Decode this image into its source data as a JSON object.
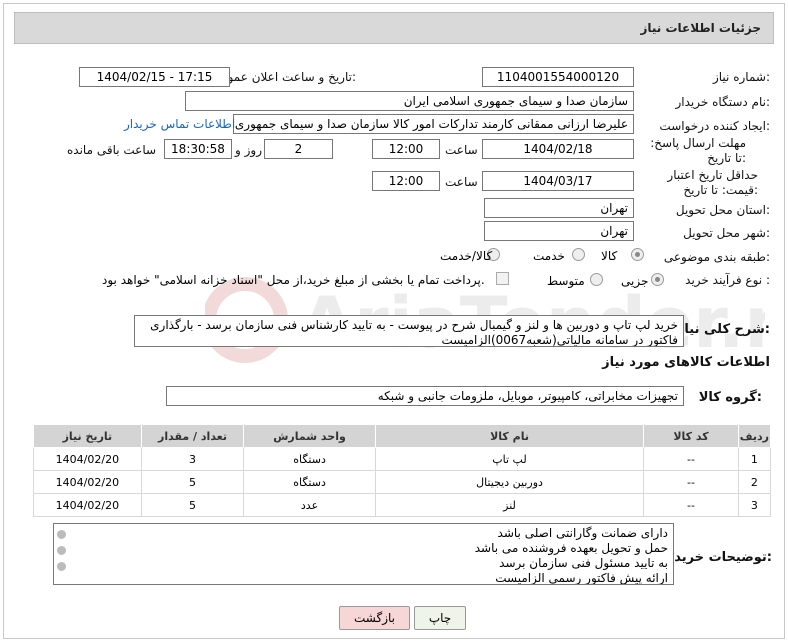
{
  "header": {
    "title": "جزئیات اطلاعات نیاز"
  },
  "fields": {
    "need_number_label": "شماره نیاز:",
    "need_number": "1104001554000120",
    "announce_label": "تاریخ و ساعت اعلان عمومی:",
    "announce_value": "1404/02/15 - 17:15",
    "buyer_org_label": "نام دستگاه خریدار:",
    "buyer_org": "سازمان صدا و سیمای جمهوری اسلامی ایران",
    "creator_label": "ایجاد کننده درخواست:",
    "creator": "علیرضا ارزانی ممقانی کارمند تدارکات امور کالا سازمان صدا و سیمای جمهوری ا",
    "contact_link": "اطلاعات تماس خریدار",
    "reply_deadline_label": "مهلت ارسال پاسخ: تا تاریخ:",
    "reply_date": "1404/02/18",
    "time_label": "ساعت",
    "reply_time": "12:00",
    "days_value": "2",
    "days_label": "روز و",
    "remaining_time": "18:30:58",
    "remaining_label": "ساعت باقی مانده",
    "price_validity_label": "حداقل تاریخ اعتبار قیمت: تا تاریخ:",
    "price_date": "1404/03/17",
    "price_time": "12:00",
    "province_label": "استان محل تحویل:",
    "province": "تهران",
    "city_label": "شهر محل تحویل:",
    "city": "تهران",
    "category_label": "طبقه بندی موضوعی:",
    "category_options": [
      "کالا",
      "خدمت",
      "کالا/خدمت"
    ],
    "process_label": "نوع فرآیند خرید :",
    "process_options": [
      "جزیی",
      "متوسط"
    ],
    "payment_note": "پرداخت تمام یا بخشی از مبلغ خرید،از محل \"اسناد خزانه اسلامی\" خواهد بود.",
    "description_label": "شرح کلی نیاز:",
    "description": "خرید لپ تاپ و دوربین ها و لنز و گیمبال شرح در پیوست - به تایید کارشناس فنی سازمان برسد - بارگذاری فاکتور در سامانه مالیاتی(شعبه0067)الزامیست",
    "goods_info_title": "اطلاعات کالاهای مورد نیاز",
    "goods_group_label": "گروه کالا:",
    "goods_group": "تجهیزات مخابراتی، کامپیوتر، موبایل، ملزومات جانبی و شبکه"
  },
  "table": {
    "headers": [
      "ردیف",
      "کد کالا",
      "نام کالا",
      "واحد شمارش",
      "تعداد / مقدار",
      "تاریخ نیاز"
    ],
    "rows": [
      [
        "1",
        "--",
        "لپ تاپ",
        "دستگاه",
        "3",
        "1404/02/20"
      ],
      [
        "2",
        "--",
        "دوربین دیجیتال",
        "دستگاه",
        "5",
        "1404/02/20"
      ],
      [
        "3",
        "--",
        "لنز",
        "عدد",
        "5",
        "1404/02/20"
      ]
    ]
  },
  "buyer_notes": {
    "label": "توضیحات خریدار:",
    "lines": [
      "دارای ضمانت وگارانتی اصلی باشد",
      "حمل و تحویل بعهده فروشنده می باشد",
      "به تایید مسئول فنی سازمان برسد",
      "ارائه پیش فاکتور رسمی الزامیست"
    ]
  },
  "buttons": {
    "print": "چاپ",
    "back": "بازگشت"
  },
  "watermark": {
    "text": "AriaTender.neT"
  },
  "colors": {
    "link": "#1c66b3",
    "back_button": "#f7d6d6",
    "print_button": "#eef5e8"
  }
}
